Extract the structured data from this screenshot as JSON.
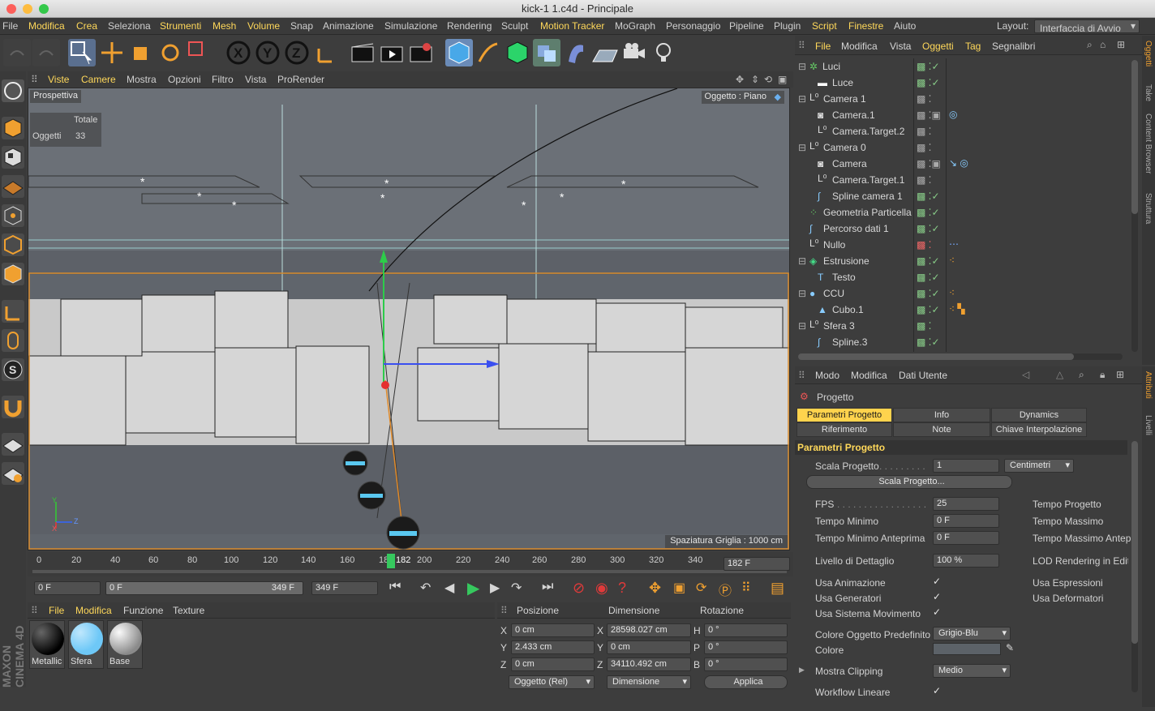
{
  "window": {
    "title": "kick-1 1.c4d - Principale"
  },
  "menu": {
    "items": [
      "File",
      "Modifica",
      "Crea",
      "Seleziona",
      "Strumenti",
      "Mesh",
      "Volume",
      "Snap",
      "Animazione",
      "Simulazione",
      "Rendering",
      "Sculpt",
      "Motion Tracker",
      "MoGraph",
      "Personaggio",
      "Pipeline",
      "Plugin",
      "Script",
      "Finestre",
      "Aiuto"
    ],
    "layout_label": "Layout:",
    "layout_value": "Interfaccia di Avvio"
  },
  "viewport": {
    "menu": [
      "Viste",
      "Camere",
      "Mostra",
      "Opzioni",
      "Filtro",
      "Vista",
      "ProRender"
    ],
    "name": "Prospettiva",
    "object_tag": "Oggetto : Piano",
    "stats_header": "Totale",
    "stats_label": "Oggetti",
    "stats_value": "33",
    "grid_spacing": "Spaziatura Griglia : 1000 cm",
    "axis_y": "Y",
    "axis_z": "Z",
    "axis_x": "X"
  },
  "timeline": {
    "ticks": [
      "0",
      "20",
      "40",
      "60",
      "80",
      "100",
      "120",
      "140",
      "160",
      "18",
      "182",
      "200",
      "220",
      "240",
      "260",
      "280",
      "300",
      "320",
      "340"
    ],
    "current_frame": "182 F",
    "start_field": "0 F",
    "range_start": "0 F",
    "range_end": "349 F",
    "end_field": "349 F"
  },
  "materials": {
    "menu": [
      "File",
      "Modifica",
      "Funzione",
      "Texture"
    ],
    "items": [
      {
        "name": "Metallic",
        "color": "#1a1a1a"
      },
      {
        "name": "Sfera",
        "color": "#6ec8f7"
      },
      {
        "name": "Base",
        "color": "#b8b8b8"
      }
    ]
  },
  "coords": {
    "headers": [
      "Posizione",
      "Dimensione",
      "Rotazione"
    ],
    "rows": [
      {
        "axis": "X",
        "pos": "0 cm",
        "dim_axis": "X",
        "dim": "28598.027 cm",
        "rot_axis": "H",
        "rot": "0 °"
      },
      {
        "axis": "Y",
        "pos": "2.433 cm",
        "dim_axis": "Y",
        "dim": "0 cm",
        "rot_axis": "P",
        "rot": "0 °"
      },
      {
        "axis": "Z",
        "pos": "0 cm",
        "dim_axis": "Z",
        "dim": "34110.492 cm",
        "rot_axis": "B",
        "rot": "0 °"
      }
    ],
    "mode": "Oggetto (Rel)",
    "size_mode": "Dimensione",
    "apply": "Applica"
  },
  "object_manager": {
    "menu": [
      "File",
      "Modifica",
      "Vista",
      "Oggetti",
      "Tag",
      "Segnalibri"
    ],
    "rows": [
      {
        "name": "Luci",
        "indent": 0
      },
      {
        "name": "Luce",
        "indent": 1
      },
      {
        "name": "Camera 1",
        "indent": 0
      },
      {
        "name": "Camera.1",
        "indent": 1
      },
      {
        "name": "Camera.Target.2",
        "indent": 1
      },
      {
        "name": "Camera 0",
        "indent": 0
      },
      {
        "name": "Camera",
        "indent": 1
      },
      {
        "name": "Camera.Target.1",
        "indent": 1
      },
      {
        "name": "Spline camera 1",
        "indent": 1
      },
      {
        "name": "Geometria Particella",
        "indent": 0
      },
      {
        "name": "Percorso dati 1",
        "indent": 0
      },
      {
        "name": "Nullo",
        "indent": 0
      },
      {
        "name": "Estrusione",
        "indent": 0
      },
      {
        "name": "Testo",
        "indent": 1
      },
      {
        "name": "CCU",
        "indent": 0
      },
      {
        "name": "Cubo.1",
        "indent": 1
      },
      {
        "name": "Sfera 3",
        "indent": 0
      },
      {
        "name": "Spline.3",
        "indent": 1
      }
    ]
  },
  "attributes": {
    "menu": [
      "Modo",
      "Modifica",
      "Dati Utente"
    ],
    "object": "Progetto",
    "tabs": [
      "Parametri Progetto",
      "Info",
      "Dynamics",
      "Riferimento",
      "Note",
      "Chiave Interpolazione"
    ],
    "section": "Parametri Progetto",
    "scale_label": "Scala Progetto",
    "scale_value": "1",
    "scale_unit": "Centimetri",
    "scale_button": "Scala Progetto...",
    "fps_label": "FPS",
    "fps_value": "25",
    "tmin_label": "Tempo Minimo",
    "tmin_value": "0 F",
    "tmin_prev_label": "Tempo Minimo Anteprima",
    "tmin_prev_value": "0 F",
    "tproj_label": "Tempo Progetto",
    "tmax_label": "Tempo Massimo",
    "tmax_prev_label": "Tempo Massimo Antep",
    "lod_label": "Livello di Dettaglio",
    "lod_value": "100 %",
    "lod_render_label": "LOD Rendering in Edito",
    "anim_label": "Usa Animazione",
    "gen_label": "Usa Generatori",
    "motion_label": "Usa Sistema Movimento",
    "expr_label": "Usa Espressioni",
    "deform_label": "Usa Deformatori",
    "color_default_label": "Colore Oggetto Predefinito",
    "color_default_value": "Grigio-Blu",
    "color_label": "Colore",
    "clipping_label": "Mostra Clipping",
    "clipping_value": "Medio",
    "workflow_label": "Workflow Lineare"
  },
  "side_tabs": {
    "right_top": [
      "Oggetti",
      "Take",
      "Content Browser",
      "Struttura"
    ],
    "right_bottom": [
      "Attributi",
      "Livelli"
    ]
  },
  "brand": "MAXON CINEMA 4D"
}
